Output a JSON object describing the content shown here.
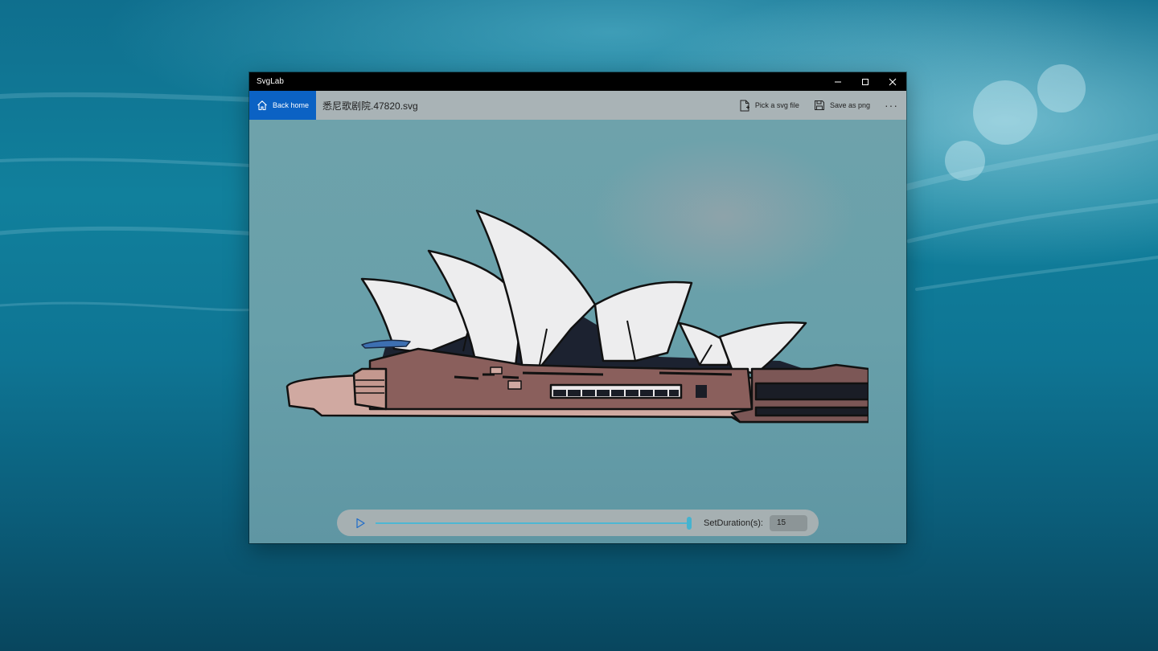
{
  "window": {
    "title": "SvgLab"
  },
  "window_controls": {
    "minimize_icon": "minimize-icon",
    "maximize_icon": "maximize-icon",
    "close_icon": "close-icon"
  },
  "toolbar": {
    "back_label": "Back home",
    "back_icon": "home-icon",
    "file_name": "悉尼歌剧院.47820.svg",
    "pick_label": "Pick a svg file",
    "pick_icon": "file-add-icon",
    "save_label": "Save as png",
    "save_icon": "save-icon",
    "more_label": "···"
  },
  "player": {
    "play_icon": "play-icon",
    "progress": 1.0,
    "duration_label": "SetDuration(s):",
    "duration_value": "15"
  },
  "colors": {
    "accent": "#0b62c4",
    "slider": "#4eb7d3",
    "titlebar": "#000000"
  }
}
